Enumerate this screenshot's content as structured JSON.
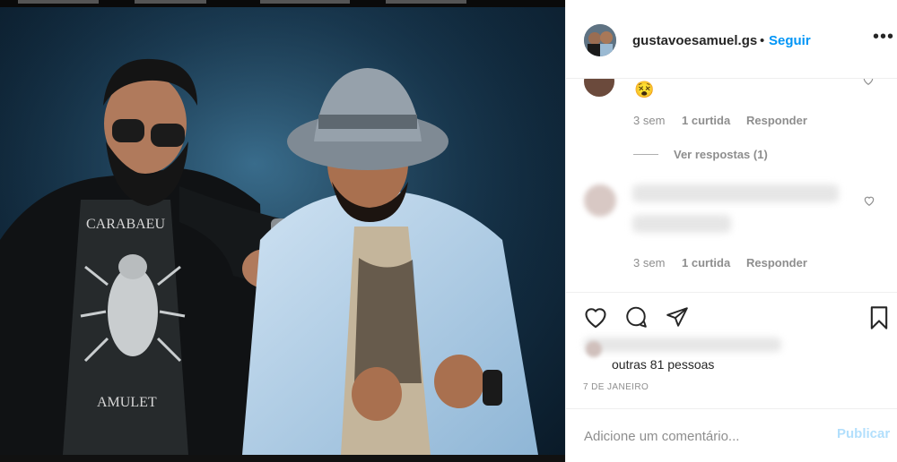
{
  "post": {
    "username": "gustavoesamuel.gs",
    "separator": "•",
    "follow_label": "Seguir",
    "more_label": "•••"
  },
  "comments": [
    {
      "emoji": "😵",
      "age": "3 sem",
      "likes": "1 curtida",
      "reply_label": "Responder",
      "view_replies": "Ver respostas (1)"
    },
    {
      "age": "3 sem",
      "likes": "1 curtida",
      "reply_label": "Responder"
    }
  ],
  "likes": {
    "others": "outras 81 pessoas"
  },
  "date": "7 DE JANEIRO",
  "add_comment": {
    "placeholder": "Adicione um comentário...",
    "publish_label": "Publicar"
  },
  "photo": {
    "shirt_top": "CARABAEU",
    "shirt_bottom": "AMULET"
  },
  "icons": [
    "heart-icon",
    "comment-icon",
    "share-icon",
    "bookmark-icon",
    "more-options-icon"
  ]
}
